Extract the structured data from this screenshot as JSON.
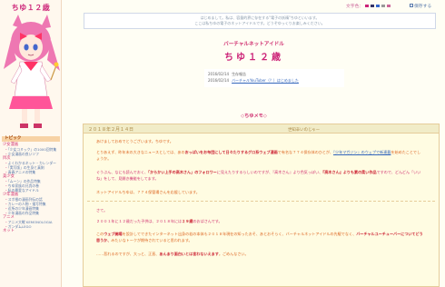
{
  "site": {
    "title": "ちゆ１２歳"
  },
  "sidebar": {
    "topics_header": "トピック",
    "groups": [
      {
        "category": "少女漫画",
        "items": [
          "「少女コミック」の1000回特集",
          "少女漫画の良いソフ"
        ]
      },
      {
        "category": "目次",
        "items": [
          "よくわかるネット・カレンダー",
          "「実写版」の生身と真剣",
          "青春アニメの特集"
        ]
      },
      {
        "category": "美少女",
        "items": [
          "「ムーン」の作品特集",
          "ちゆ家族の兄貴の巻",
          "私の最愛なアイドル"
        ]
      },
      {
        "category": "少年漫画",
        "items": [
          "スポ根の漫画列伝の話",
          "カレーの人物・描写特集",
          "近所の少年漫画特集",
          "少年漫画の作品特集"
        ]
      },
      {
        "category": "アニメ",
        "items": [
          "アニメ大戦 KEMONOLOGIA",
          "ガンダムLEGO"
        ]
      },
      {
        "category": "ネット",
        "items": []
      }
    ]
  },
  "topbar": {
    "fontsize_label": "文字色：",
    "swatches": [
      "#cc2277",
      "#333366",
      "#3366cc",
      "#999999",
      "#cc6699"
    ],
    "save_label": "保存する"
  },
  "intro": {
    "line1": "はじめまして。私は、容量的界に存在する\"電子の妖精\"ちゆといいます。",
    "line2": "ここは私ちゆの電子のネットアイドルです。どうぞゆっくりお楽しみください。"
  },
  "header": {
    "subtitle": "バーチャルネットアイドル",
    "title": "ちゆ１２歳"
  },
  "news": [
    {
      "date": "2016/02/14",
      "text": "生存報告",
      "link": ""
    },
    {
      "date": "2016/02/14",
      "text": "",
      "link": "バーチャルYouTuber（？）はじめました"
    }
  ],
  "memo_heading": "◇ちゆメモ◇",
  "article": {
    "date": "２０１８年２月１４日",
    "title": "世知辛いのじゃー",
    "p1": "あけましておめでとうございます。ちゆです。",
    "p2a": "とりあえず、昨年末の大きなニュースとしては、あの",
    "p2b": "おっぱいをお布団にして日々たりするグロ系ウェブ漫画",
    "p2c": "で有名な７７４保存体のひとが、",
    "p2d": "『少年マガジン』のウェブで新連載",
    "p2e": "を始めたことでしょうか。",
    "p3a": "ぐうぶん、なにも読んでおく、",
    "p3b": "「からかい上手の高木さん」のフォロワー",
    "p3c": "に見えたりするらしいのですが、",
    "p3d": "『高木さん』より色気っぽい、",
    "p3e": "『高木さん』よりも素の柔い作品",
    "p3f": "ですので、どんどん「いいね」をして、見開き機能をしてます。",
    "p4": "ネットアイドルちゆは、７７４保管場さんを応援しています。",
    "p5": "さて。",
    "p6a": "２００１年に１２歳だった子供は、２０１８年には",
    "p6b": "２９歳",
    "p6c": "のおばさんです。",
    "p7a": "この",
    "p7b": "ウェブ開場",
    "p7c": "を設計してできたインターネット出身の若の本体も２０１８年現在の知ったおそ、あとおそらく、バーチャルネットアイドルの先駆でなく、",
    "p7d": "バーチャルユーチューバーについてどう思うか、",
    "p7e": "みたいなトークが期待されていると思われます。",
    "p8a": "……悲れるのですが、大っと、正直、",
    "p8b": "あんまり面白いとは言わないえます",
    "p8c": "。ごめんなさい。"
  }
}
